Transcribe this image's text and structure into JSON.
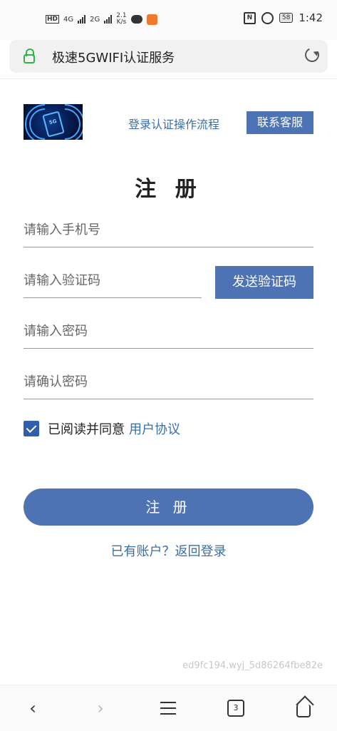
{
  "status_bar": {
    "network_speed": "2.1\nK/s",
    "net_label_1": "4G",
    "net_label_2": "2G",
    "hd": "HD",
    "battery": "58",
    "time": "1:42"
  },
  "address_bar": {
    "title": "极速5GWIFI认证服务"
  },
  "header": {
    "logo_text": "5G",
    "flow_link": "登录认证操作流程",
    "service_button": "联系客服"
  },
  "form": {
    "title": "注 册",
    "phone_placeholder": "请输入手机号",
    "code_placeholder": "请输入验证码",
    "send_code_button": "发送验证码",
    "password_placeholder": "请输入密码",
    "confirm_placeholder": "请确认密码",
    "agree_checked": true,
    "agree_text": "已阅读并同意",
    "agree_link": "用户协议",
    "register_button": "注 册",
    "login_link": "已有账户？返回登录"
  },
  "watermark": "ed9fc194.wyj_5d86264fbe82e",
  "bottom_nav": {
    "tabs_count": "3"
  },
  "colors": {
    "accent": "#4d73b4",
    "link": "#3a6fa6",
    "lock": "#2db34a"
  }
}
